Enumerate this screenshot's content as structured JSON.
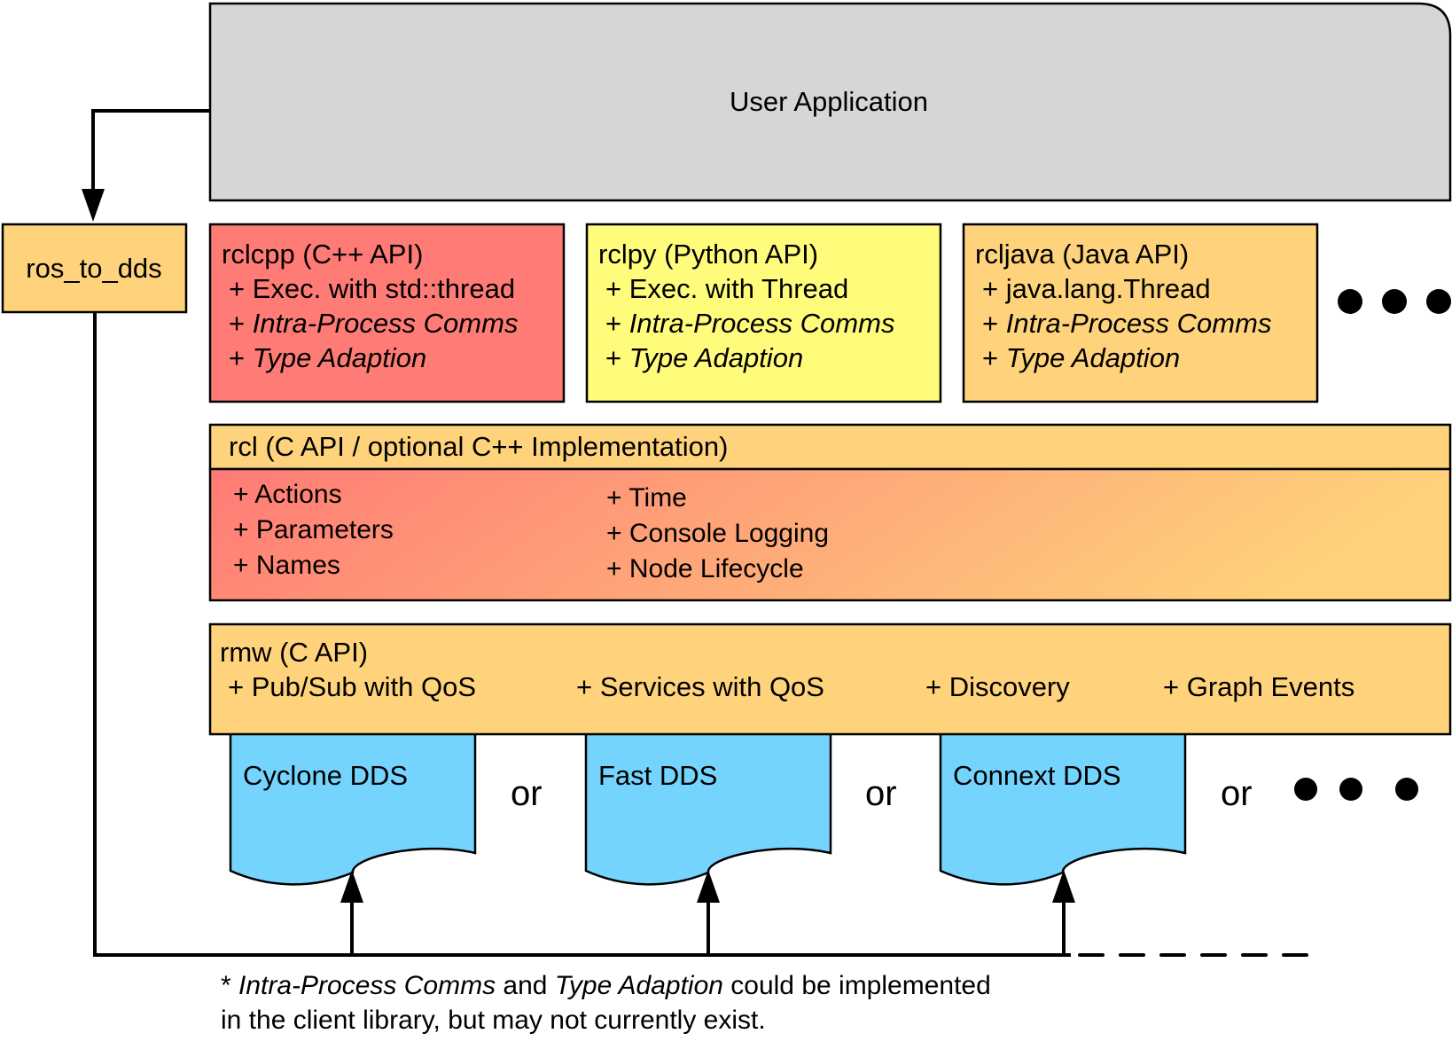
{
  "user_application": {
    "label": "User Application",
    "color": "#d6d6d6"
  },
  "ros_to_dds": {
    "label": "ros_to_dds",
    "color": "#fed37b"
  },
  "client_libraries": [
    {
      "title": "rclcpp (C++ API)",
      "color": "#ff7b76",
      "items": [
        {
          "text": "+ Exec. with std::thread",
          "italic": false
        },
        {
          "text": "+ Intra-Process Comms",
          "italic": true
        },
        {
          "text": "+ Type Adaption",
          "italic": true
        }
      ]
    },
    {
      "title": "rclpy (Python API)",
      "color": "#fffb7b",
      "items": [
        {
          "text": "+ Exec. with Thread",
          "italic": false
        },
        {
          "text": "+ Intra-Process Comms",
          "italic": true
        },
        {
          "text": "+ Type Adaption",
          "italic": true
        }
      ]
    },
    {
      "title": "rcljava (Java API)",
      "color": "#fed37b",
      "items": [
        {
          "text": "+ java.lang.Thread",
          "italic": false
        },
        {
          "text": "+ Intra-Process Comms",
          "italic": true
        },
        {
          "text": "+ Type Adaption",
          "italic": true
        }
      ]
    }
  ],
  "rcl": {
    "title": "rcl (C API / optional C++ Implementation)",
    "header_color": "#fed37b",
    "gradient": [
      "#ff7b76",
      "#fed37b"
    ],
    "items_left": [
      "+ Actions",
      "+ Parameters",
      "+ Names"
    ],
    "items_right": [
      "+ Time",
      "+ Console Logging",
      "+ Node Lifecycle"
    ]
  },
  "rmw": {
    "title": "rmw (C API)",
    "color": "#fed37b",
    "items": [
      "+ Pub/Sub with QoS",
      "+ Services with QoS",
      "+ Discovery",
      "+ Graph Events"
    ]
  },
  "dds_implementations": [
    {
      "label": "Cyclone DDS"
    },
    {
      "label": "Fast DDS"
    },
    {
      "label": "Connext DDS"
    }
  ],
  "dds_color": "#75d4fe",
  "separator_word": "or",
  "footnote": {
    "line1": [
      {
        "text": "* ",
        "italic": false
      },
      {
        "text": "Intra-Process Comms",
        "italic": true
      },
      {
        "text": " and ",
        "italic": false
      },
      {
        "text": "Type Adaption",
        "italic": true
      },
      {
        "text": " could be implemented",
        "italic": false
      }
    ],
    "line2": "in the client library, but may not currently exist."
  }
}
